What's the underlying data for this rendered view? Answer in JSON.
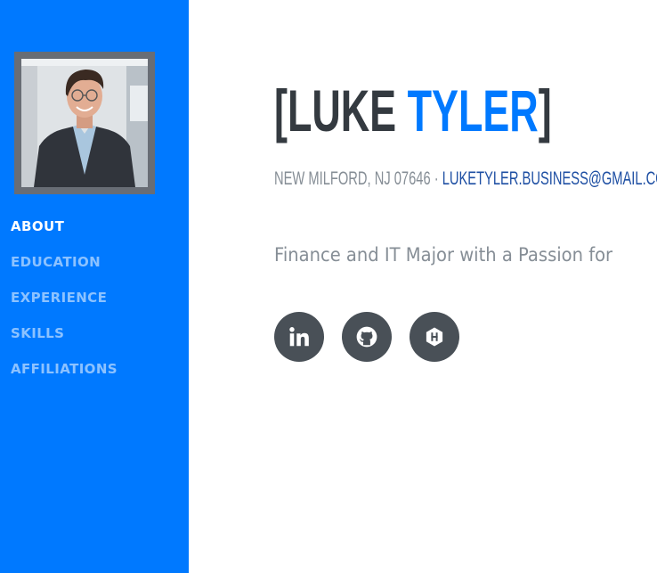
{
  "sidebar": {
    "nav": [
      {
        "label": "ABOUT",
        "active": true
      },
      {
        "label": "EDUCATION",
        "active": false
      },
      {
        "label": "EXPERIENCE",
        "active": false
      },
      {
        "label": "SKILLS",
        "active": false
      },
      {
        "label": "AFFILIATIONS",
        "active": false
      }
    ]
  },
  "header": {
    "bracket_open": "[",
    "first_name": "LUKE",
    "last_name": "TYLER",
    "bracket_close": "]"
  },
  "subheading": {
    "location": "NEW MILFORD, NJ 07646 · ",
    "email": "LUKETYLER.BUSINESS@GMAIL.COM"
  },
  "lead": "Finance and IT Major with a Passion for",
  "social": [
    {
      "icon": "linkedin-icon"
    },
    {
      "icon": "github-icon"
    },
    {
      "icon": "hackerrank-icon"
    }
  ],
  "colors": {
    "sidebar": "#0079ff",
    "accent": "#0079ff",
    "heading": "#343a40",
    "muted": "#868e96",
    "social_button": "#495057"
  }
}
